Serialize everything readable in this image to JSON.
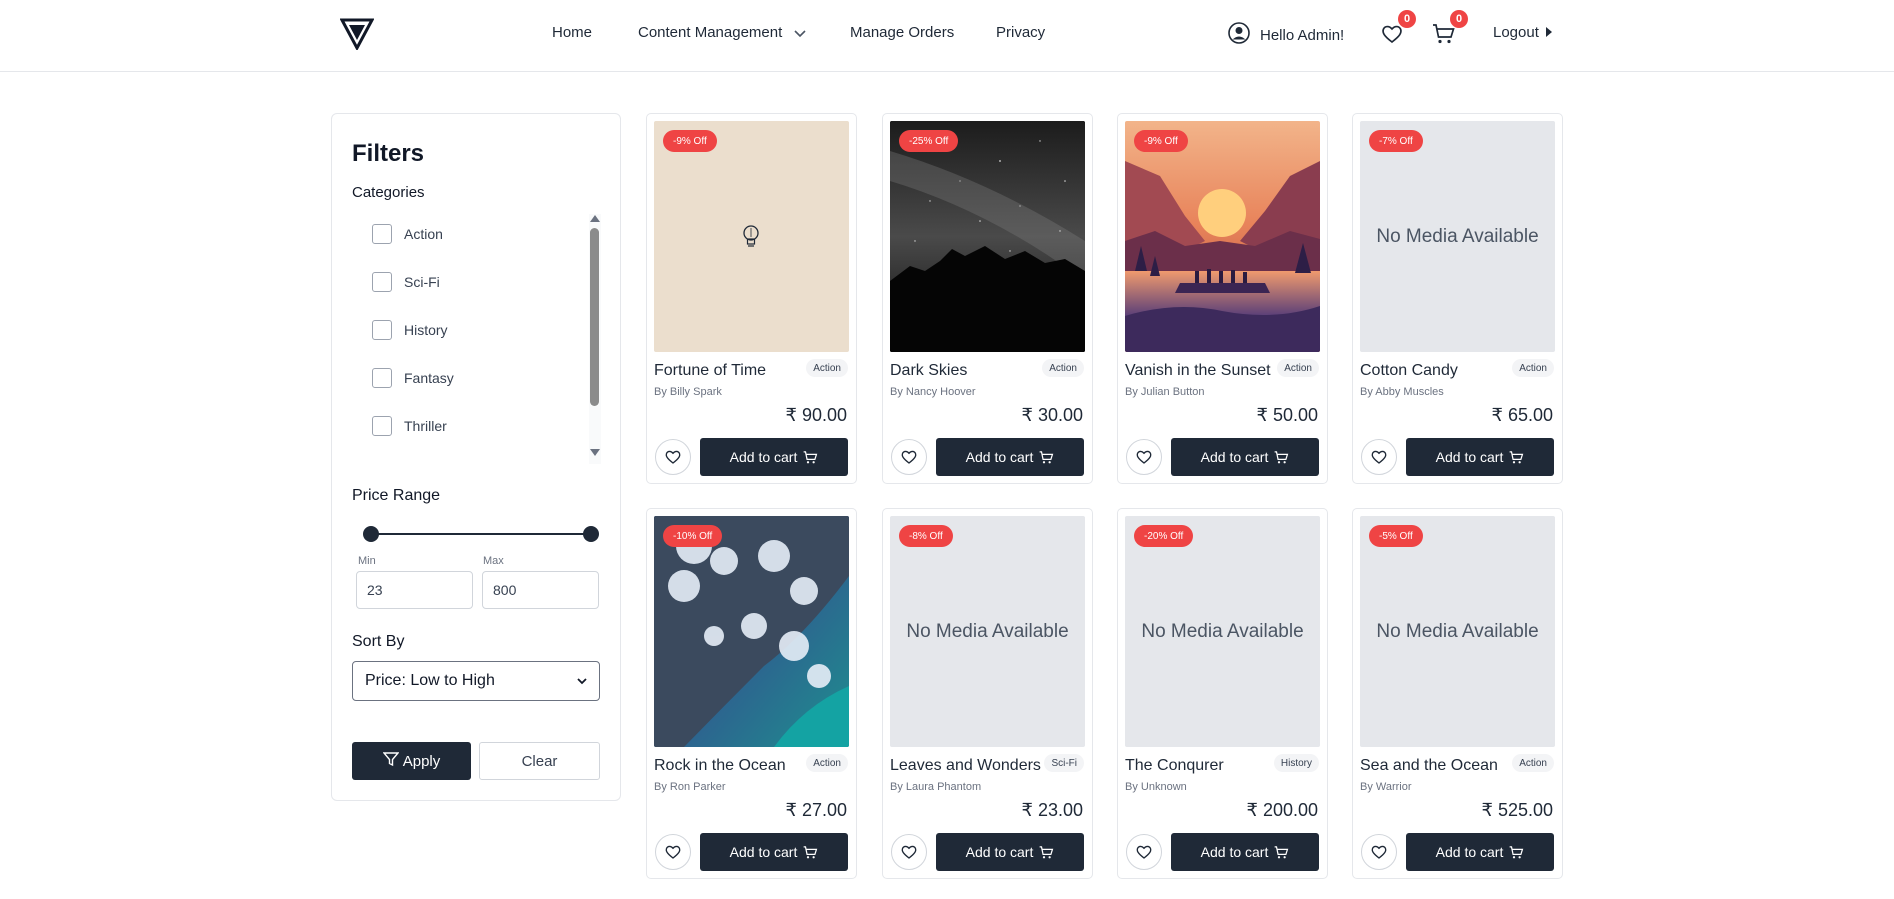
{
  "header": {
    "nav": [
      {
        "label": "Home"
      },
      {
        "label": "Content Management",
        "icon": "chevron-down-icon"
      },
      {
        "label": "Manage Orders"
      },
      {
        "label": "Privacy"
      }
    ],
    "greeting": "Hello Admin!",
    "wishlist_count": "0",
    "cart_count": "0",
    "logout_label": "Logout"
  },
  "filters": {
    "title": "Filters",
    "categories_label": "Categories",
    "categories": [
      "Action",
      "Sci-Fi",
      "History",
      "Fantasy",
      "Thriller"
    ],
    "price_label": "Price Range",
    "min_label": "Min",
    "max_label": "Max",
    "min_value": "23",
    "max_value": "800",
    "sort_label": "Sort By",
    "sort_value": "Price: Low to High",
    "apply_label": "Apply",
    "clear_label": "Clear"
  },
  "cart_label": "Add to cart",
  "no_media_label": "No Media Available",
  "products": [
    {
      "title": "Fortune of Time",
      "author": "By Billy Spark",
      "category": "Action",
      "price": "₹ 90.00",
      "discount": "-9% Off",
      "image": "lightbulb"
    },
    {
      "title": "Dark Skies",
      "author": "By Nancy Hoover",
      "category": "Action",
      "price": "₹ 30.00",
      "discount": "-25% Off",
      "image": "night-sky"
    },
    {
      "title": "Vanish in the Sunset",
      "author": "By Julian Button",
      "category": "Action",
      "price": "₹ 50.00",
      "discount": "-9% Off",
      "image": "sunset"
    },
    {
      "title": "Cotton Candy",
      "author": "By Abby Muscles",
      "category": "Action",
      "price": "₹ 65.00",
      "discount": "-7% Off",
      "image": "none"
    },
    {
      "title": "Rock in the Ocean",
      "author": "By Ron Parker",
      "category": "Action",
      "price": "₹ 27.00",
      "discount": "-10% Off",
      "image": "ocean"
    },
    {
      "title": "Leaves and Wonders",
      "author": "By Laura Phantom",
      "category": "Sci-Fi",
      "price": "₹ 23.00",
      "discount": "-8% Off",
      "image": "none"
    },
    {
      "title": "The Conqurer",
      "author": "By Unknown",
      "category": "History",
      "price": "₹ 200.00",
      "discount": "-20% Off",
      "image": "none"
    },
    {
      "title": "Sea and the Ocean",
      "author": "By Warrior",
      "category": "Action",
      "price": "₹ 525.00",
      "discount": "-5% Off",
      "image": "none"
    }
  ],
  "colors": {
    "primary": "#1f2937",
    "badge": "#ef4444",
    "placeholder": "#e5e7eb"
  }
}
